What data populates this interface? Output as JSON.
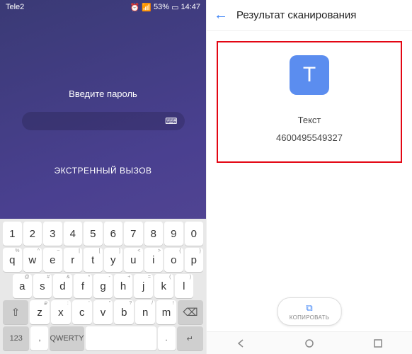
{
  "left": {
    "status": {
      "carrier": "Tele2",
      "battery_pct": "53%",
      "time": "14:47"
    },
    "password_prompt": "Введите пароль",
    "emergency": "ЭКСТРЕННЫЙ ВЫЗОВ",
    "keyboard": {
      "row1": [
        "1",
        "2",
        "3",
        "4",
        "5",
        "6",
        "7",
        "8",
        "9",
        "0"
      ],
      "row2": [
        {
          "k": "q",
          "s": "%"
        },
        {
          "k": "w",
          "s": "^"
        },
        {
          "k": "e",
          "s": "~"
        },
        {
          "k": "r",
          "s": "|"
        },
        {
          "k": "t",
          "s": "["
        },
        {
          "k": "y",
          "s": "]"
        },
        {
          "k": "u",
          "s": "<"
        },
        {
          "k": "i",
          "s": ">"
        },
        {
          "k": "o",
          "s": "{"
        },
        {
          "k": "p",
          "s": "}"
        }
      ],
      "row3": [
        {
          "k": "a",
          "s": "@"
        },
        {
          "k": "s",
          "s": "#"
        },
        {
          "k": "d",
          "s": "&"
        },
        {
          "k": "f",
          "s": "*"
        },
        {
          "k": "g",
          "s": "-"
        },
        {
          "k": "h",
          "s": "+"
        },
        {
          "k": "j",
          "s": "="
        },
        {
          "k": "k",
          "s": "("
        },
        {
          "k": "l",
          "s": ")"
        }
      ],
      "row4": [
        {
          "k": "z",
          "s": "₽"
        },
        {
          "k": "x",
          "s": ":"
        },
        {
          "k": "c",
          "s": "'"
        },
        {
          "k": "v",
          "s": "\""
        },
        {
          "k": "b",
          "s": "?"
        },
        {
          "k": "n",
          "s": "/"
        },
        {
          "k": "m",
          "s": "!"
        }
      ],
      "switch": "123",
      "layout": "QWERTY",
      "shift": "⇧",
      "backspace": "⌫",
      "enter": "↵",
      "comma": ",",
      "period": "."
    }
  },
  "right": {
    "title": "Результат сканирования",
    "icon_letter": "T",
    "label": "Текст",
    "value": "4600495549327",
    "copy": "КОПИРОВАТЬ"
  }
}
